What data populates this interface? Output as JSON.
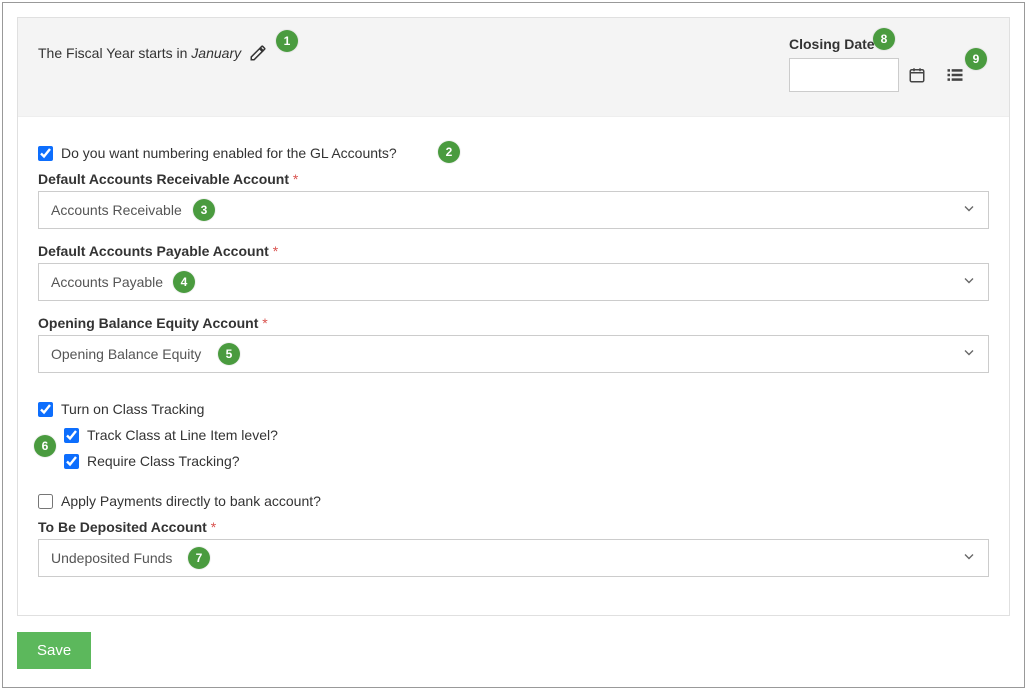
{
  "header": {
    "fiscal_year_prefix": "The Fiscal Year starts in ",
    "fiscal_year_month": "January",
    "closing_date_label": "Closing Date",
    "closing_date_value": ""
  },
  "checkboxes": {
    "numbering_enabled_label": "Do you want numbering enabled for the GL Accounts?",
    "numbering_enabled_checked": true,
    "class_tracking_label": "Turn on Class Tracking",
    "class_tracking_checked": true,
    "track_class_line_label": "Track Class at Line Item level?",
    "track_class_line_checked": true,
    "require_class_label": "Require Class Tracking?",
    "require_class_checked": true,
    "apply_payments_label": "Apply Payments directly to bank account?",
    "apply_payments_checked": false
  },
  "fields": {
    "ar_label": "Default Accounts Receivable Account",
    "ar_value": "Accounts Receivable",
    "ap_label": "Default Accounts Payable Account",
    "ap_value": "Accounts Payable",
    "obe_label": "Opening Balance Equity Account",
    "obe_value": "Opening Balance Equity",
    "tbd_label": "To Be Deposited Account",
    "tbd_value": "Undeposited Funds",
    "required_marker": "*"
  },
  "buttons": {
    "save": "Save"
  },
  "callouts": {
    "c1": "1",
    "c2": "2",
    "c3": "3",
    "c4": "4",
    "c5": "5",
    "c6": "6",
    "c7": "7",
    "c8": "8",
    "c9": "9"
  }
}
